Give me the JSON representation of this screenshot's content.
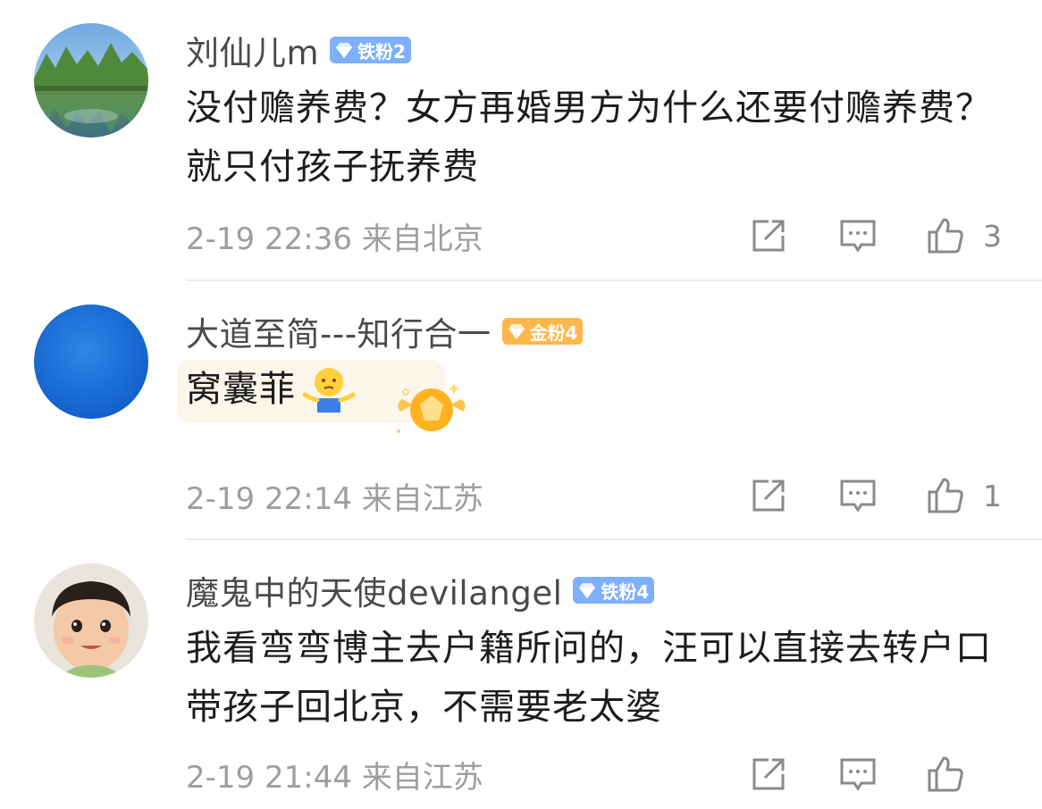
{
  "comments": [
    {
      "username": "刘仙儿m",
      "badge": "铁粉2",
      "badge_type": "iron",
      "text": "没付赡养费？女方再婚男方为什么还要付赡养费？就只付孩子抚养费",
      "meta": "2-19 22:36 来自北京",
      "likes": "3",
      "avatar": "landscape-photo"
    },
    {
      "username": "大道至简---知行合一",
      "badge": "金粉4",
      "badge_type": "gold",
      "text": "窝囊菲",
      "meta": "2-19 22:14 来自江苏",
      "likes": "1",
      "avatar": "blue-circle",
      "emoji": "shrug-emoji",
      "sticker": "gold-fan-sticker"
    },
    {
      "username": "魔鬼中的天使devilangel",
      "badge": "铁粉4",
      "badge_type": "iron",
      "text": "我看弯弯博主去户籍所问的，汪可以直接去转户口带孩子回北京，不需要老太婆",
      "meta": "2-19 21:44 来自江苏",
      "likes": "",
      "avatar": "child-photo"
    }
  ],
  "icons": {
    "share": "share-icon",
    "comment": "comment-icon",
    "like": "thumbs-up-icon"
  },
  "colors": {
    "iron_badge": "#7fb0ff",
    "gold_badge": "#ffb64a",
    "meta_text": "#9e9e9e"
  }
}
